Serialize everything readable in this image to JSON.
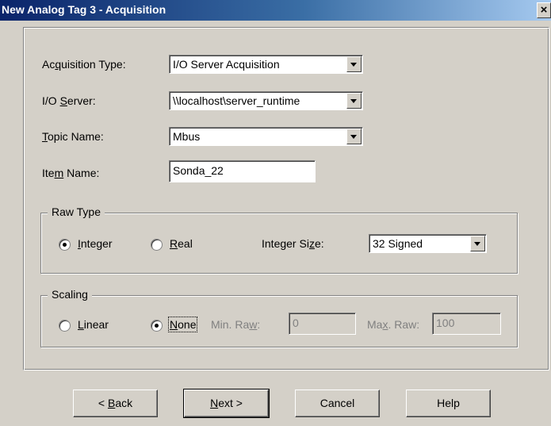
{
  "window": {
    "title": "New Analog Tag 3 - Acquisition",
    "close_glyph": "×"
  },
  "fields": {
    "acquisition_type": {
      "label_pre": "Ac",
      "label_key": "q",
      "label_post": "uisition Type:",
      "value": "I/O Server Acquisition"
    },
    "io_server": {
      "label_pre": "I/O ",
      "label_key": "S",
      "label_post": "erver:",
      "value": "\\\\localhost\\server_runtime"
    },
    "topic_name": {
      "label_pre": "",
      "label_key": "T",
      "label_post": "opic Name:",
      "value": "Mbus"
    },
    "item_name": {
      "label_pre": "Ite",
      "label_key": "m",
      "label_post": " Name:",
      "value": "Sonda_22"
    }
  },
  "raw_type": {
    "legend": "Raw Type",
    "integer": {
      "label_pre": "",
      "label_key": "I",
      "label_post": "nteger",
      "selected": true
    },
    "real": {
      "label_pre": "",
      "label_key": "R",
      "label_post": "eal",
      "selected": false
    },
    "integer_size": {
      "label_pre": "Integer Si",
      "label_key": "z",
      "label_post": "e:",
      "value": "32 Signed"
    }
  },
  "scaling": {
    "legend": "Scaling",
    "linear": {
      "label_pre": "",
      "label_key": "L",
      "label_post": "inear",
      "selected": false
    },
    "none": {
      "label_pre": "",
      "label_key": "N",
      "label_post": "one",
      "selected": true
    },
    "min_raw": {
      "label_pre": "Min. Ra",
      "label_key": "w",
      "label_post": ":",
      "value": "0"
    },
    "max_raw": {
      "label_pre": "Ma",
      "label_key": "x",
      "label_post": ". Raw:",
      "value": "100"
    }
  },
  "buttons": {
    "back": {
      "pre": "< ",
      "key": "B",
      "post": "ack"
    },
    "next": {
      "pre": "",
      "key": "N",
      "post": "ext >"
    },
    "cancel": "Cancel",
    "help": "Help"
  },
  "colors": {
    "face": "#d4d0c8",
    "title_start": "#0a246a",
    "title_end": "#a6caf0",
    "disabled_text": "#808080"
  }
}
